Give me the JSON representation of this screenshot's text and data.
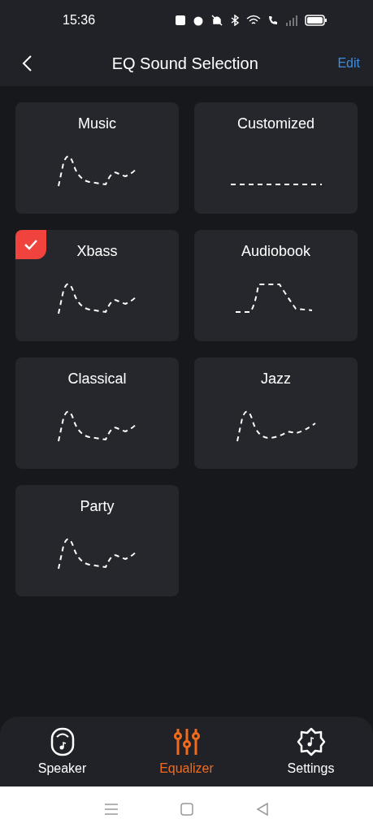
{
  "status_bar": {
    "time": "15:36"
  },
  "header": {
    "title": "EQ Sound Selection",
    "action": "Edit"
  },
  "presets": [
    {
      "label": "Music",
      "kind": "peak",
      "selected": false
    },
    {
      "label": "Customized",
      "kind": "flat",
      "selected": false
    },
    {
      "label": "Xbass",
      "kind": "peak",
      "selected": true
    },
    {
      "label": "Audiobook",
      "kind": "plateau",
      "selected": false
    },
    {
      "label": "Classical",
      "kind": "peak",
      "selected": false
    },
    {
      "label": "Jazz",
      "kind": "dip",
      "selected": false
    },
    {
      "label": "Party",
      "kind": "peak",
      "selected": false
    }
  ],
  "tabs": [
    {
      "label": "Speaker",
      "kind": "speaker",
      "selected": false
    },
    {
      "label": "Equalizer",
      "kind": "equalizer",
      "selected": true
    },
    {
      "label": "Settings",
      "kind": "settings",
      "selected": false
    }
  ]
}
